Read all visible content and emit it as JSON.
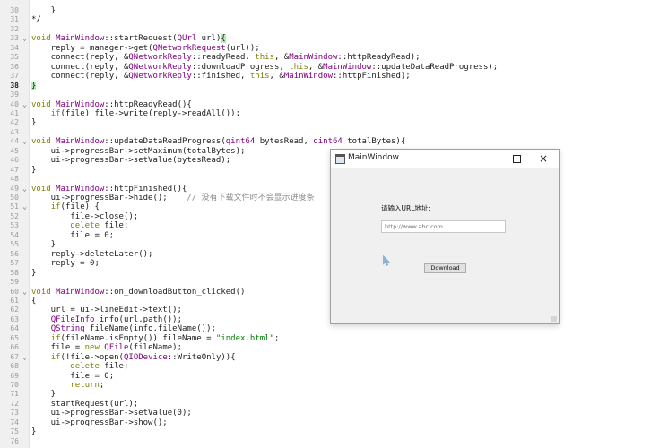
{
  "editor": {
    "current_line": 38,
    "lines": [
      {
        "n": 30,
        "fold": "",
        "html": "    }"
      },
      {
        "n": 31,
        "fold": "",
        "html": "*/"
      },
      {
        "n": 32,
        "fold": "",
        "html": ""
      },
      {
        "n": 33,
        "fold": "v",
        "html": "void MainWindow::startRequest(QUrl url){"
      },
      {
        "n": 34,
        "fold": "",
        "html": "    reply = manager->get(QNetworkRequest(url));"
      },
      {
        "n": 35,
        "fold": "",
        "html": "    connect(reply, &QNetworkReply::readyRead, this, &MainWindow::httpReadyRead);"
      },
      {
        "n": 36,
        "fold": "",
        "html": "    connect(reply, &QNetworkReply::downloadProgress, this, &MainWindow::updateDataReadProgress);"
      },
      {
        "n": 37,
        "fold": "",
        "html": "    connect(reply, &QNetworkReply::finished, this, &MainWindow::httpFinished);"
      },
      {
        "n": 38,
        "fold": "",
        "html": "}"
      },
      {
        "n": 39,
        "fold": "",
        "html": ""
      },
      {
        "n": 40,
        "fold": "v",
        "html": "void MainWindow::httpReadyRead(){"
      },
      {
        "n": 41,
        "fold": "",
        "html": "    if(file) file->write(reply->readAll());"
      },
      {
        "n": 42,
        "fold": "",
        "html": "}"
      },
      {
        "n": 43,
        "fold": "",
        "html": ""
      },
      {
        "n": 44,
        "fold": "v",
        "html": "void MainWindow::updateDataReadProgress(qint64 bytesRead, qint64 totalBytes){"
      },
      {
        "n": 45,
        "fold": "",
        "html": "    ui->progressBar->setMaximum(totalBytes);"
      },
      {
        "n": 46,
        "fold": "",
        "html": "    ui->progressBar->setValue(bytesRead);"
      },
      {
        "n": 47,
        "fold": "",
        "html": "}"
      },
      {
        "n": 48,
        "fold": "",
        "html": ""
      },
      {
        "n": 49,
        "fold": "v",
        "html": "void MainWindow::httpFinished(){"
      },
      {
        "n": 50,
        "fold": "",
        "html": "    ui->progressBar->hide();    // 没有下载文件时不会显示进度条"
      },
      {
        "n": 51,
        "fold": "v",
        "html": "    if(file) {"
      },
      {
        "n": 52,
        "fold": "",
        "html": "        file->close();"
      },
      {
        "n": 53,
        "fold": "",
        "html": "        delete file;"
      },
      {
        "n": 54,
        "fold": "",
        "html": "        file = 0;"
      },
      {
        "n": 55,
        "fold": "",
        "html": "    }"
      },
      {
        "n": 56,
        "fold": "",
        "html": "    reply->deleteLater();"
      },
      {
        "n": 57,
        "fold": "",
        "html": "    reply = 0;"
      },
      {
        "n": 58,
        "fold": "",
        "html": "}"
      },
      {
        "n": 59,
        "fold": "",
        "html": ""
      },
      {
        "n": 60,
        "fold": "v",
        "html": "void MainWindow::on_downloadButton_clicked()"
      },
      {
        "n": 61,
        "fold": "",
        "html": "{"
      },
      {
        "n": 62,
        "fold": "",
        "html": "    url = ui->lineEdit->text();"
      },
      {
        "n": 63,
        "fold": "",
        "html": "    QFileInfo info(url.path());"
      },
      {
        "n": 64,
        "fold": "",
        "html": "    QString fileName(info.fileName());"
      },
      {
        "n": 65,
        "fold": "",
        "html": "    if(fileName.isEmpty()) fileName = \"index.html\";"
      },
      {
        "n": 66,
        "fold": "",
        "html": "    file = new QFile(fileName);"
      },
      {
        "n": 67,
        "fold": "v",
        "html": "    if(!file->open(QIODevice::WriteOnly)){"
      },
      {
        "n": 68,
        "fold": "",
        "html": "        delete file;"
      },
      {
        "n": 69,
        "fold": "",
        "html": "        file = 0;"
      },
      {
        "n": 70,
        "fold": "",
        "html": "        return;"
      },
      {
        "n": 71,
        "fold": "",
        "html": "    }"
      },
      {
        "n": 72,
        "fold": "",
        "html": "    startRequest(url);"
      },
      {
        "n": 73,
        "fold": "",
        "html": "    ui->progressBar->setValue(0);"
      },
      {
        "n": 74,
        "fold": "",
        "html": "    ui->progressBar->show();"
      },
      {
        "n": 75,
        "fold": "",
        "html": "}"
      },
      {
        "n": 76,
        "fold": "",
        "html": ""
      }
    ]
  },
  "window": {
    "title": "MainWindow",
    "url_label": "请输入URL地址:",
    "url_placeholder": "http://www.abc.com",
    "download_label": "Download",
    "minimize_icon": "minimize-icon",
    "maximize_icon": "maximize-icon",
    "close_icon": "close-icon",
    "close_glyph": "×"
  },
  "colors": {
    "keyword": "#808000",
    "type": "#800080",
    "function": "#00677c",
    "string": "#008000",
    "brace_match": "#b4f0b4"
  }
}
